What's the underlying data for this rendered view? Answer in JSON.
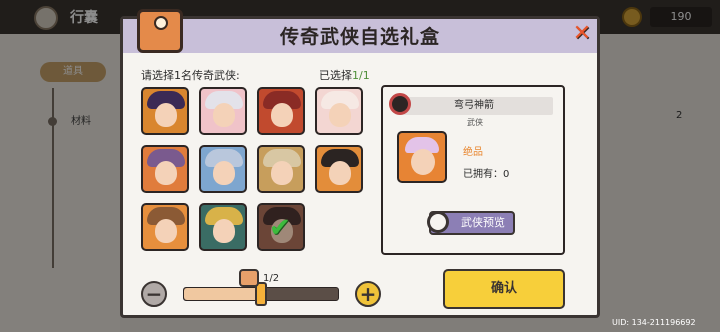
{
  "background": {
    "title": "行囊",
    "coins": "190",
    "nav": {
      "tab": "道具",
      "sub": "材料"
    },
    "side_number": "2",
    "uid": "UID: 134-211196692"
  },
  "dialog": {
    "title": "传奇武侠自选礼盒",
    "prompt": "请选择1名传奇武侠:",
    "selected_label": "已选择",
    "selected_count": "1/1",
    "close_symbol": "✕"
  },
  "heroes": [
    {
      "bg": "#d9862f",
      "hair": "#3b2a55",
      "selected": false
    },
    {
      "bg": "#f0c3c9",
      "hair": "#e3e2ea",
      "selected": false
    },
    {
      "bg": "#c14a2e",
      "hair": "#8a2b25",
      "selected": false
    },
    {
      "bg": "#f3d6d2",
      "hair": "#f6e9e4",
      "selected": false
    },
    {
      "bg": "#e07c3c",
      "hair": "#7a5a8e",
      "selected": false
    },
    {
      "bg": "#7ea6cf",
      "hair": "#b9c7dc",
      "selected": false
    },
    {
      "bg": "#c79e5c",
      "hair": "#d8c7a3",
      "selected": false
    },
    {
      "bg": "#e38d3a",
      "hair": "#2b2422",
      "selected": false
    },
    {
      "bg": "#e68f3d",
      "hair": "#8b5a35",
      "selected": false
    },
    {
      "bg": "#3a6c64",
      "hair": "#d8b249",
      "selected": false
    },
    {
      "bg": "#a56b55",
      "hair": "#4b3430",
      "selected": true
    }
  ],
  "detail": {
    "name": "弯弓神箭",
    "role": "武侠",
    "quality": "绝品",
    "owned": "已拥有：0",
    "preview_button": "武侠预览"
  },
  "quantity": {
    "current": "1/2",
    "fraction": 0.5
  },
  "confirm_button": "确认"
}
